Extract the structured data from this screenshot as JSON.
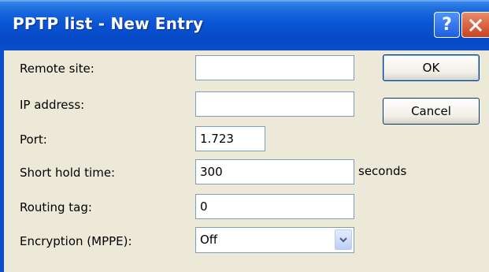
{
  "window": {
    "title": "PPTP list - New Entry",
    "help_glyph": "?",
    "close_icon": "close-icon"
  },
  "form": {
    "remote_site_label": "Remote site:",
    "remote_site_value": "",
    "ip_address_label": "IP address:",
    "ip_address_value": "",
    "port_label": "Port:",
    "port_value": "1.723",
    "short_hold_label": "Short hold time:",
    "short_hold_value": "300",
    "short_hold_unit": "seconds",
    "routing_tag_label": "Routing tag:",
    "routing_tag_value": "0",
    "encryption_label": "Encryption (MPPE):",
    "encryption_value": "Off"
  },
  "buttons": {
    "ok_label": "OK",
    "cancel_label": "Cancel"
  },
  "colors": {
    "titlebar": "#0a55d6",
    "client_bg": "#ece9d8",
    "field_border": "#7f9db9",
    "close_button": "#c8421f"
  }
}
